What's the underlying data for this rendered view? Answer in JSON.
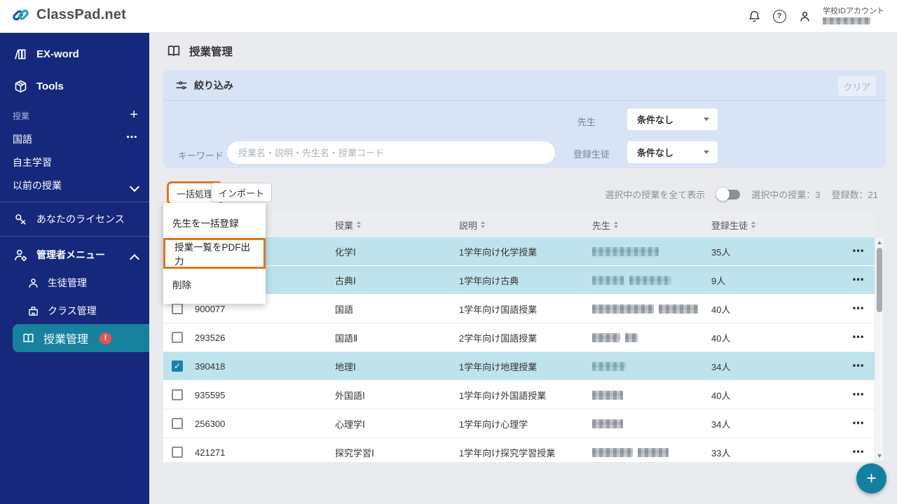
{
  "header": {
    "brand": "ClassPad.net",
    "account_type": "学校IDアカウント"
  },
  "icons": {
    "plus": "+",
    "ellipsis": "⋯",
    "question": "?",
    "exclamation": "!",
    "check": "✓"
  },
  "sidebar": {
    "ex_word": "EX-word",
    "tools": "Tools",
    "class_section_label": "授業",
    "kokugo": "国語",
    "self_study": "自主学習",
    "previous_classes": "以前の授業",
    "license": "あなたのライセンス",
    "admin_menu": "管理者メニュー",
    "student_mgmt": "生徒管理",
    "class_mgmt": "クラス管理",
    "lesson_mgmt": "授業管理"
  },
  "page": {
    "title": "授業管理"
  },
  "filter": {
    "title": "絞り込み",
    "clear": "クリア",
    "keyword_label": "キーワード",
    "keyword_placeholder": "授業名・説明・先生名・授業コード",
    "teacher_label": "先生",
    "teacher_value": "条件なし",
    "student_label": "登録生徒",
    "student_value": "条件なし"
  },
  "toolbar": {
    "bulk": "一括処理",
    "import": "インポート",
    "show_selected": "選択中の授業を全て表示",
    "selected_count": "選択中の授業：3",
    "total_count": "登録数：21"
  },
  "menu": {
    "items": [
      "先生を一括登録",
      "授業一覧をPDF出力",
      "削除"
    ],
    "highlighted_index": 1
  },
  "table": {
    "headers": [
      "授業",
      "説明",
      "先生",
      "登録生徒"
    ],
    "rows": [
      {
        "code": "",
        "name": "化学Ⅰ",
        "desc": "1学年向け化学授業",
        "students": "35人",
        "selected": true,
        "checked": true,
        "teacher_blur": [
          95
        ]
      },
      {
        "code": "",
        "name": "古典Ⅰ",
        "desc": "1学年向け古典",
        "students": "9人",
        "selected": true,
        "checked": true,
        "teacher_blur": [
          46,
          60
        ]
      },
      {
        "code": "900077",
        "name": "国語",
        "desc": "1学年向け国語授業",
        "students": "40人",
        "selected": false,
        "checked": false,
        "teacher_blur": [
          88,
          56
        ]
      },
      {
        "code": "293526",
        "name": "国語Ⅱ",
        "desc": "2学年向け国語授業",
        "students": "40人",
        "selected": false,
        "checked": false,
        "teacher_blur": [
          40,
          18
        ]
      },
      {
        "code": "390418",
        "name": "地理Ⅰ",
        "desc": "1学年向け地理授業",
        "students": "34人",
        "selected": true,
        "checked": true,
        "teacher_blur": [
          48
        ]
      },
      {
        "code": "935595",
        "name": "外国語Ⅰ",
        "desc": "1学年向け外国語授業",
        "students": "40人",
        "selected": false,
        "checked": false,
        "teacher_blur": [
          44
        ]
      },
      {
        "code": "256300",
        "name": "心理学Ⅰ",
        "desc": "1学年向け心理学",
        "students": "34人",
        "selected": false,
        "checked": false,
        "teacher_blur": [
          44
        ]
      },
      {
        "code": "421271",
        "name": "探究学習Ⅰ",
        "desc": "1学年向け探究学習授業",
        "students": "33人",
        "selected": false,
        "checked": false,
        "teacher_blur": [
          58,
          44
        ]
      }
    ]
  },
  "colors": {
    "sidebar_bg": "#15287b",
    "active_item": "#16829e",
    "selected_row": "#bfe3ec",
    "filter_bg": "#d9e3f6",
    "highlight_orange": "#e0771b",
    "fab_teal": "#13809f",
    "alert_red": "#e8534e"
  }
}
